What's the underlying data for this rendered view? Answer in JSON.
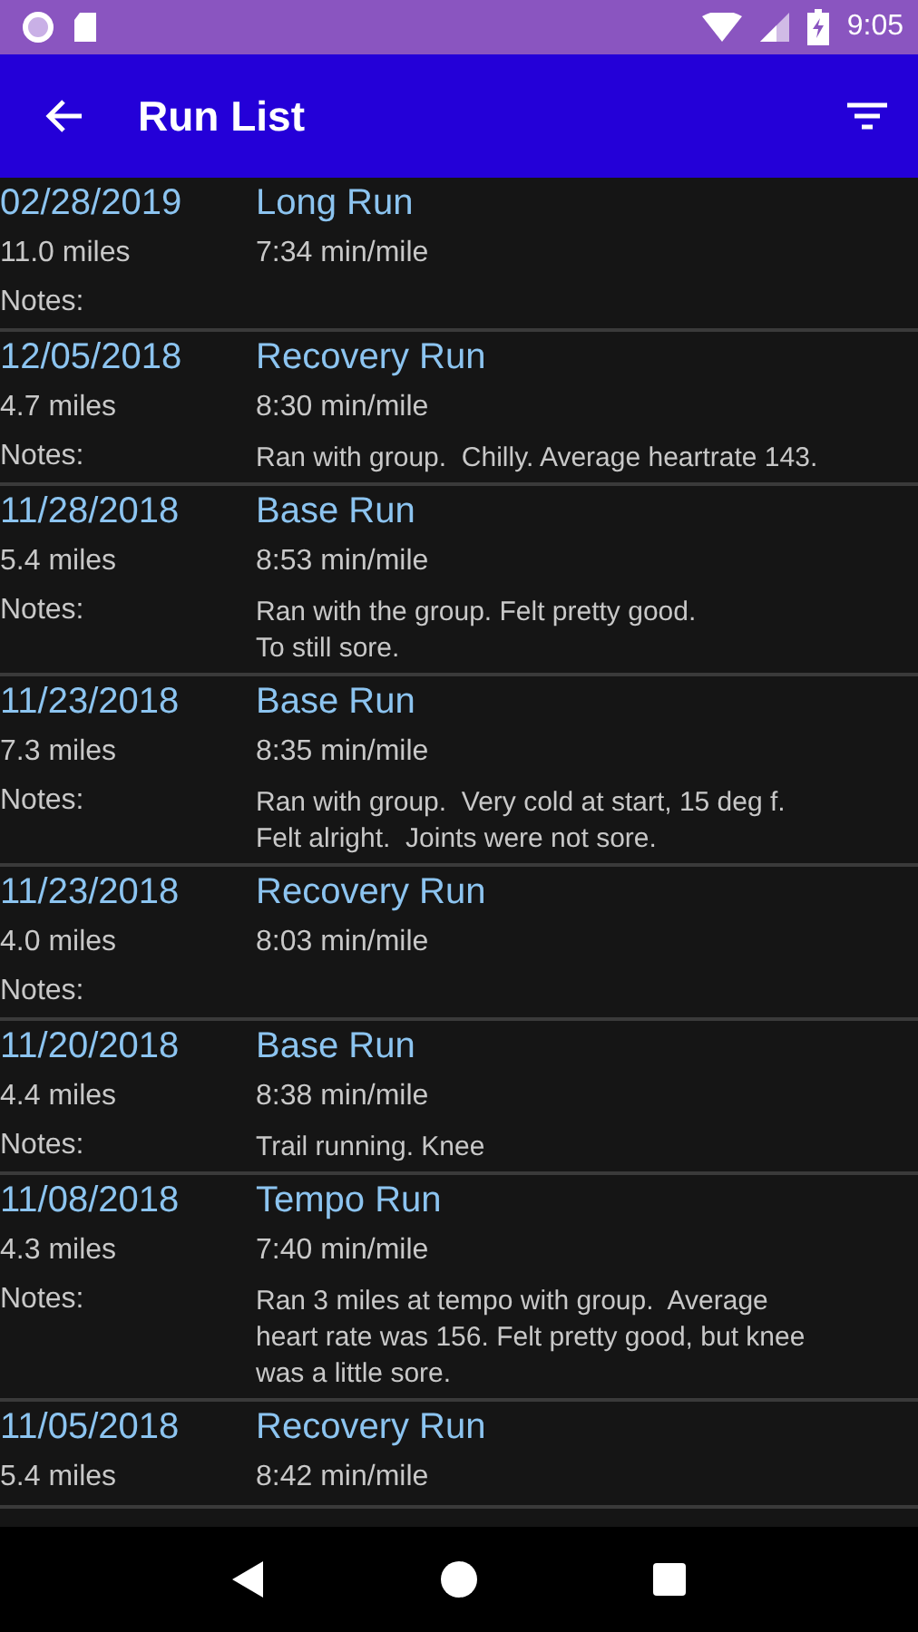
{
  "status_bar": {
    "time": "9:05"
  },
  "app_bar": {
    "title": "Run List"
  },
  "runs": [
    {
      "date": "02/28/2019",
      "type": "Long Run",
      "distance": "11.0 miles",
      "pace": "7:34 min/mile",
      "notes_label": "Notes:"
    },
    {
      "date": "12/05/2018",
      "type": "Recovery Run",
      "distance": "4.7 miles",
      "pace": "8:30 min/mile",
      "notes_label": "Notes:",
      "notes": "Ran with group.  Chilly. Average heartrate 143."
    },
    {
      "date": "11/28/2018",
      "type": "Base Run",
      "distance": "5.4 miles",
      "pace": "8:53 min/mile",
      "notes_label": "Notes:",
      "notes": "Ran with the group. Felt pretty good.\nTo still sore."
    },
    {
      "date": "11/23/2018",
      "type": "Base Run",
      "distance": "7.3 miles",
      "pace": "8:35 min/mile",
      "notes_label": "Notes:",
      "notes": "Ran with group.  Very cold at start, 15 deg f.\nFelt alright.  Joints were not sore."
    },
    {
      "date": "11/23/2018",
      "type": "Recovery Run",
      "distance": "4.0 miles",
      "pace": "8:03 min/mile",
      "notes_label": "Notes:"
    },
    {
      "date": "11/20/2018",
      "type": "Base Run",
      "distance": "4.4 miles",
      "pace": "8:38 min/mile",
      "notes_label": "Notes:",
      "notes": "Trail running. Knee"
    },
    {
      "date": "11/08/2018",
      "type": "Tempo Run",
      "distance": "4.3 miles",
      "pace": "7:40 min/mile",
      "notes_label": "Notes:",
      "notes": "Ran 3 miles at tempo with group.  Average\nheart rate was 156. Felt pretty good, but knee\nwas a little sore."
    },
    {
      "date": "11/05/2018",
      "type": "Recovery Run",
      "distance": "5.4 miles",
      "pace": "8:42 min/mile"
    }
  ]
}
